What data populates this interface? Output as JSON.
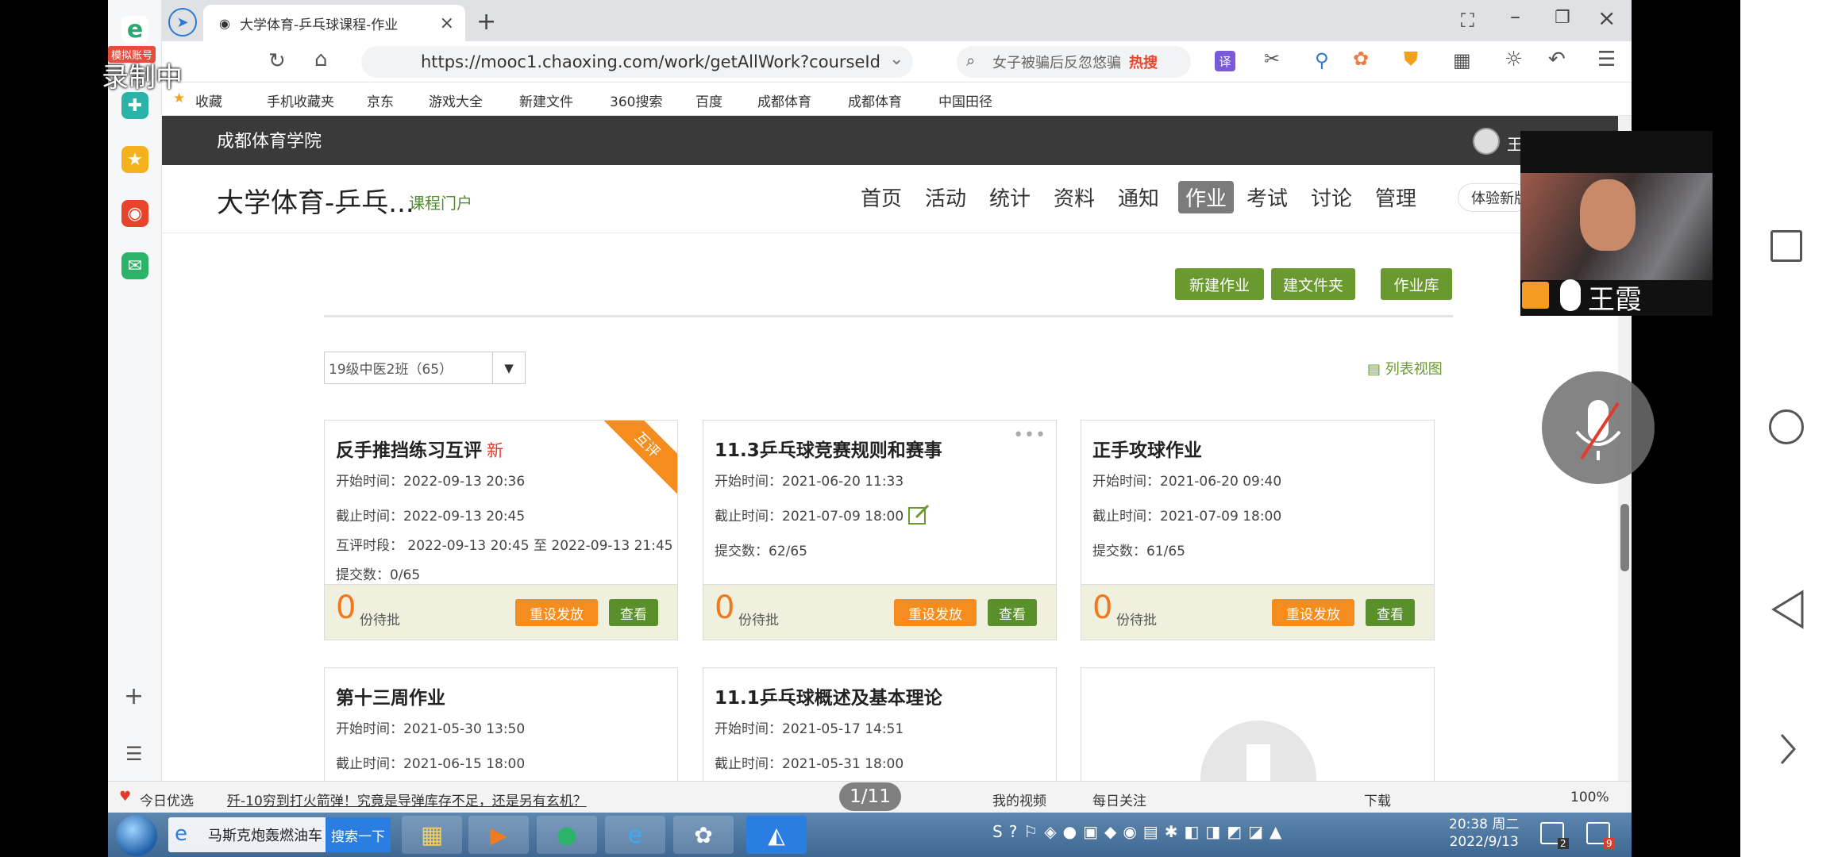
{
  "recording": {
    "label": "录制中",
    "badge": "模拟账号"
  },
  "browser": {
    "tab_title": "大学体育-乒乓球课程-作业",
    "url": "https://mooc1.chaoxing.com/work/getAllWork?courseId",
    "search_text": "女子被骗后反忽悠骗",
    "hot_label": "热搜"
  },
  "bookmarks": [
    "收藏",
    "手机收藏夹",
    "京东",
    "游戏大全",
    "新建文件",
    "360搜索",
    "百度",
    "成都体育",
    "成都体育",
    "中国田径"
  ],
  "site": {
    "school": "成都体育学院",
    "user": "王",
    "course_title": "大学体育-乒乓...",
    "course_portal": "课程门户",
    "nav": [
      "首页",
      "活动",
      "统计",
      "资料",
      "通知",
      "作业",
      "考试",
      "讨论",
      "管理"
    ],
    "nav_active": "作业",
    "experience": "体验新版"
  },
  "actions": {
    "new_work": "新建作业",
    "new_folder": "建文件夹",
    "work_library": "作业库"
  },
  "filter": {
    "class_select": "19级中医2班（65）",
    "list_view": "列表视图"
  },
  "cards": [
    {
      "title": "反手推挡练习互评",
      "tag": "新",
      "ribbon": "互评",
      "start": "开始时间：2022-09-13 20:36",
      "end": "截止时间：2022-09-13 20:45",
      "peer": "互评时段： 2022-09-13 20:45 至 2022-09-13 21:45",
      "submit": "提交数：0/65",
      "pending_count": "0",
      "pending_label": "份待批",
      "reset": "重设发放",
      "view": "查看"
    },
    {
      "title": "11.3乒乓球竞赛规则和赛事",
      "start": "开始时间：2021-06-20 11:33",
      "end": "截止时间：2021-07-09 18:00",
      "submit": "提交数：62/65",
      "pending_count": "0",
      "pending_label": "份待批",
      "reset": "重设发放",
      "view": "查看"
    },
    {
      "title": "正手攻球作业",
      "start": "开始时间：2021-06-20 09:40",
      "end": "截止时间：2021-07-09 18:00",
      "submit": "提交数：61/65",
      "pending_count": "0",
      "pending_label": "份待批",
      "reset": "重设发放",
      "view": "查看"
    },
    {
      "title": "第十三周作业",
      "start": "开始时间：2021-05-30 13:50",
      "end": "截止时间：2021-06-15 18:00"
    },
    {
      "title": "11.1乒乓球概述及基本理论",
      "start": "开始时间：2021-05-17 14:51",
      "end": "截止时间：2021-05-31 18:00"
    }
  ],
  "statusbar": {
    "today": "今日优选",
    "news": "歼-10穷到打火箭弹！究竟是导弹库存不足，还是另有玄机？",
    "my_video": "我的视频",
    "daily": "每日关注",
    "download": "下载",
    "zoom": "100%"
  },
  "page_indicator": "1/11",
  "taskbar": {
    "ie_label": "马斯克炮轰燃油车",
    "search_btn": "搜索一下",
    "time": "20:38 周二",
    "date": "2022/9/13",
    "badge_2": "2",
    "badge_9": "9"
  },
  "video": {
    "speaker": "王霞"
  },
  "colors": {
    "accent_green": "#6a9a2f",
    "orange": "#f48c1e",
    "header_dark": "#3a3a3a"
  }
}
